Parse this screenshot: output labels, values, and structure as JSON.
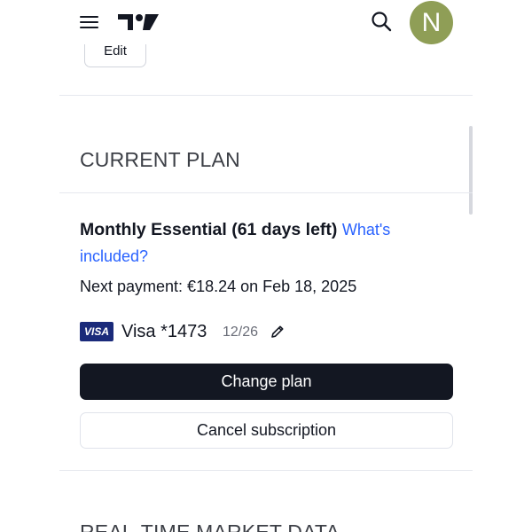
{
  "header": {
    "menu_icon": "hamburger-menu-icon",
    "logo_icon": "tradingview-logo-icon",
    "search_icon": "search-icon",
    "avatar_initial": "N",
    "avatar_color": "#8f9e56"
  },
  "profile": {
    "edit_label": "Edit"
  },
  "current_plan": {
    "section_title": "CURRENT PLAN",
    "plan_name": "Monthly Essential (61 days left)",
    "whats_included_link": "What's included?",
    "next_payment": "Next payment: €18.24 on Feb 18, 2025",
    "card": {
      "brand_badge": "VISA",
      "name": "Visa *1473",
      "expiry": "12/26",
      "edit_icon": "pencil-icon"
    },
    "change_plan_button": "Change plan",
    "cancel_subscription_button": "Cancel subscription"
  },
  "next_section": {
    "title": "REAL-TIME MARKET DATA"
  },
  "colors": {
    "primary_button": "#131722",
    "link": "#2962ff",
    "visa_badge": "#1a2a7a"
  }
}
